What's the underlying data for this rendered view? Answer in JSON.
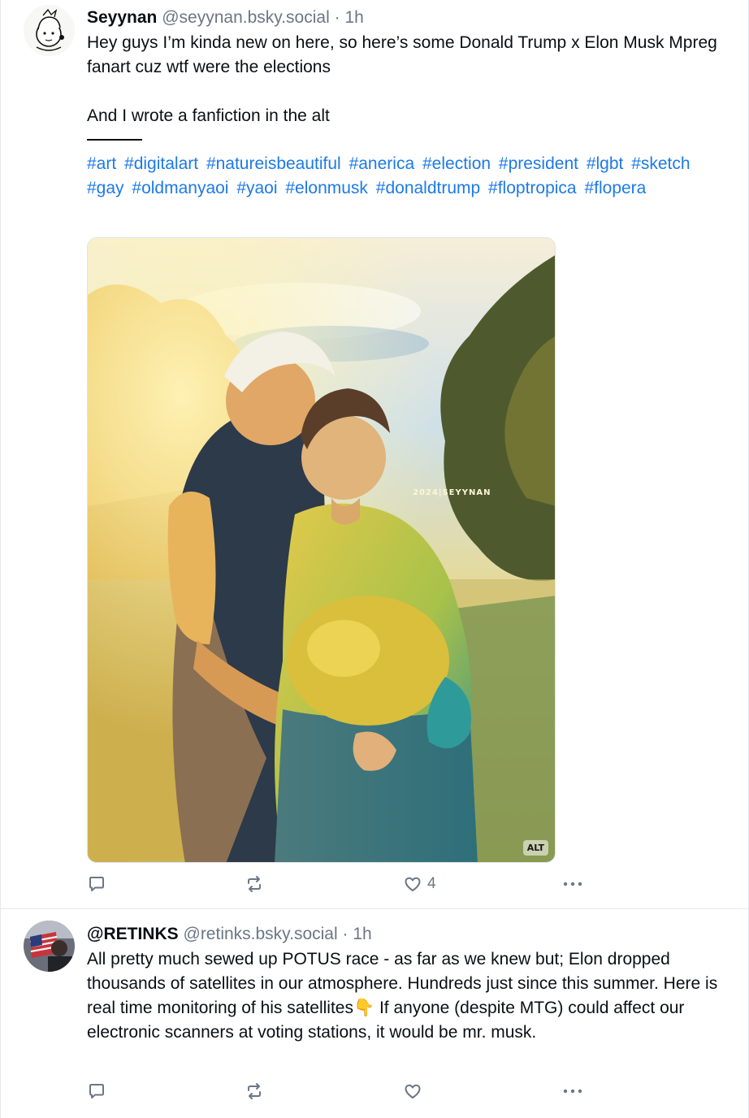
{
  "posts": [
    {
      "author_name": "Seyynan",
      "author_handle": "@seyynan.bsky.social",
      "separator": "·",
      "time": "1h",
      "text_lines": [
        "Hey guys I’m kinda new on here, so here’s some Donald Trump x Elon Musk Mpreg fanart cuz wtf were the elections",
        "And I wrote a fanfiction in the alt"
      ],
      "hashtags": [
        "#art",
        "#digitalart",
        "#natureisbeautiful",
        "#anerica",
        "#election",
        "#president",
        "#lgbt",
        "#sketch",
        "#gay",
        "#oldmanyaoi",
        "#yaoi",
        "#elonmusk",
        "#donaldtrump",
        "#floptropica",
        "#flopera"
      ],
      "image": {
        "watermark": "2024|SEYYNAN",
        "alt_badge": "ALT"
      },
      "actions": {
        "reply_icon": "reply-icon",
        "repost_icon": "repost-icon",
        "like_icon": "heart-icon",
        "like_count": "4",
        "more_icon": "more-icon"
      }
    },
    {
      "author_name": "@RETINKS",
      "author_handle": "@retinks.bsky.social",
      "separator": "·",
      "time": "1h",
      "text": "All pretty much sewed up POTUS race - as far as we knew but; Elon dropped thousands of satellites in our atmosphere. Hundreds just since this summer. Here is real time monitoring of his satellites👇 If anyone (despite MTG) could affect our electronic scanners at voting stations, it would be mr. musk.",
      "actions": {
        "reply_icon": "reply-icon",
        "repost_icon": "repost-icon",
        "like_icon": "heart-icon",
        "more_icon": "more-icon"
      }
    }
  ],
  "colors": {
    "link": "#1d7ae6",
    "muted": "#6b7785",
    "text": "#0b0f14",
    "border": "#e6e9ee"
  }
}
